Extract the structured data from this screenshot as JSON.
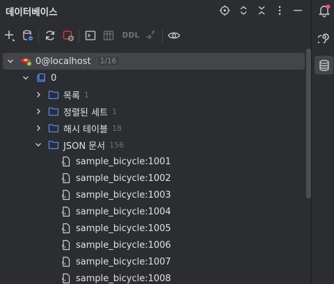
{
  "header": {
    "title": "데이터베이스"
  },
  "toolbar": {
    "ddl_label": "DDL"
  },
  "tree": {
    "connection": {
      "label": "0@localhost",
      "badge": "1/16"
    },
    "database": {
      "label": "0"
    },
    "groups": [
      {
        "label": "목록",
        "count": "1"
      },
      {
        "label": "정렬된 세트",
        "count": "1"
      },
      {
        "label": "해시 테이블",
        "count": "18"
      },
      {
        "label": "JSON 문서",
        "count": "156"
      }
    ],
    "keys": [
      "sample_bicycle:1001",
      "sample_bicycle:1002",
      "sample_bicycle:1003",
      "sample_bicycle:1004",
      "sample_bicycle:1005",
      "sample_bicycle:1006",
      "sample_bicycle:1007",
      "sample_bicycle:1008"
    ]
  },
  "colors": {
    "accent_blue": "#548af7",
    "redis_red": "#d63b33",
    "icon_gray": "#ced0d6",
    "disabled_gray": "#6f737a"
  }
}
